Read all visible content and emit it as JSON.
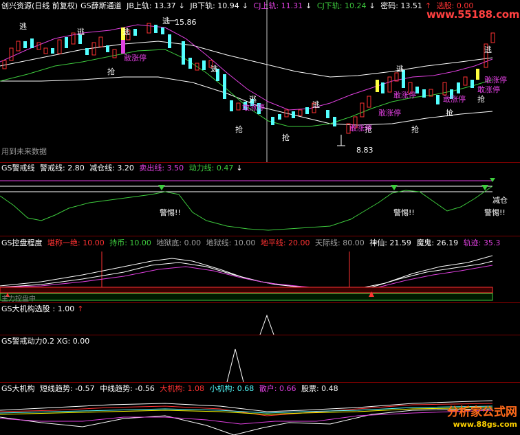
{
  "main": {
    "title": "创兴资源(日线 前复权)",
    "indicator": "GS薛斯通道",
    "jb_up": "JB上轨: 13.37",
    "jb_down": "JB下轨: 10.94",
    "cj_up": "CJ上轨: 11.31",
    "cj_down": "CJ下轨: 10.24",
    "password": "密码: 13.51",
    "pick": "选股: 0.00",
    "watermark_top": "www.55188.com",
    "note": "用到未来数据",
    "high_label": "15.86",
    "low_label": "8.83",
    "arrows": [
      "↓",
      "↓",
      "↓",
      "↓",
      "↓",
      "↑"
    ],
    "tag_escape": "逃",
    "tag_grab": "抢",
    "tag_limit": "敢涨停"
  },
  "alert": {
    "title": "GS警戒线",
    "warn": "警戒线: 2.80",
    "reduce": "减仓线: 3.20",
    "sell": "卖出线: 3.50",
    "power": "动力线: 0.47",
    "tag_alert": "警惕!!",
    "tag_reduce": "减仓"
  },
  "control": {
    "title": "GS控盘程度",
    "peak": "堪称一绝: 10.00",
    "hold": "持币: 10.00",
    "hell_bottom": "地狱底: 0.00",
    "hell_line": "地狱线: 10.00",
    "horizon": "地平线: 20.00",
    "sky": "天际线: 80.00",
    "god": "神仙: 21.59",
    "devil": "魔鬼: 26.19",
    "track": "轨迹: 35.3",
    "bar_text": "主力控盘中"
  },
  "inst": {
    "title": "GS大机构选股",
    "value": ": 1.00"
  },
  "power2": {
    "title": "GS警戒动力0.2 XG: 0.00"
  },
  "big": {
    "title": "GS大机构",
    "short": "短线趋势: -0.57",
    "mid": "中线趋势: -0.56",
    "bigi": "大机构: 1.08",
    "small": "小机构: 0.68",
    "retail": "散户: 0.66",
    "stock": "股票: 0.48"
  },
  "footer": {
    "brand": "分析家公式网",
    "url": "www.88gs.com"
  },
  "colors": {
    "bg": "#000000",
    "up": "#ff3232",
    "down": "#54ffff",
    "magenta": "#e040e0",
    "green": "#3ecc3e",
    "white": "#ffffff",
    "yellow": "#ffff00"
  }
}
